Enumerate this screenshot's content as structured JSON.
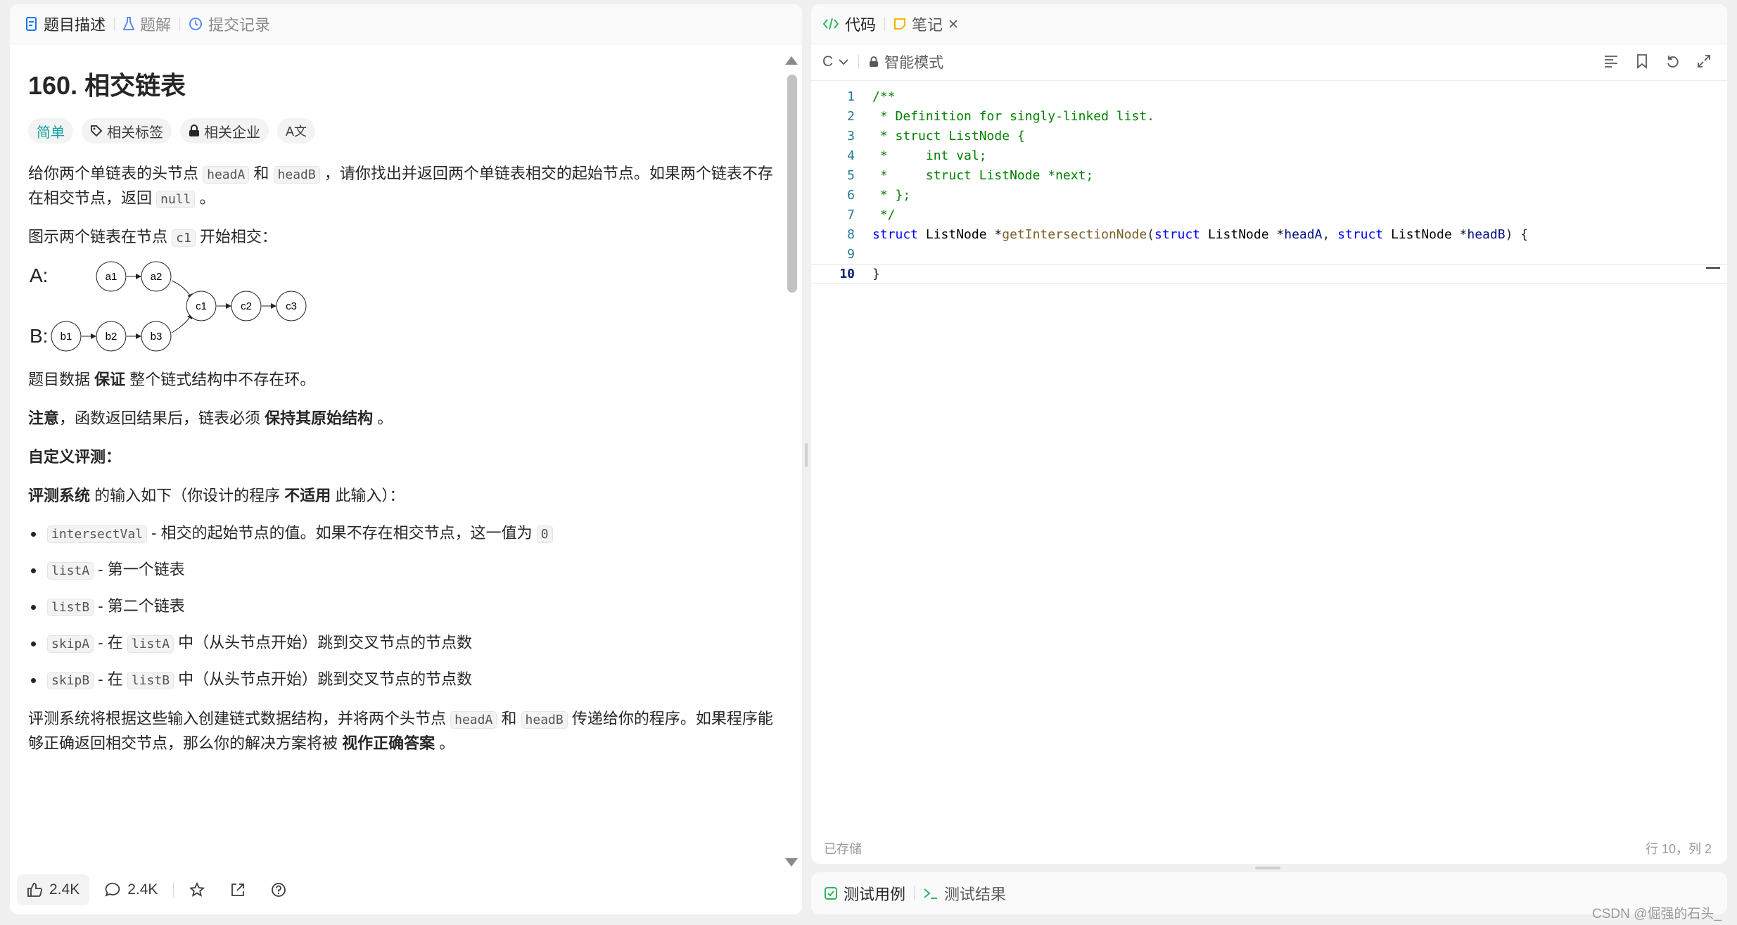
{
  "left_tabs": [
    {
      "label": "题目描述",
      "icon": "document-icon"
    },
    {
      "label": "题解",
      "icon": "flask-icon"
    },
    {
      "label": "提交记录",
      "icon": "history-icon"
    }
  ],
  "problem": {
    "title": "160. 相交链表",
    "tags": {
      "difficulty": "简单",
      "related_tags": "相关标签",
      "related_companies": "相关企业",
      "translate": "A文"
    },
    "intro": {
      "t1": "给你两个单链表的头节点 ",
      "c1": "headA",
      "t2": " 和 ",
      "c2": "headB",
      "t3": " ，请你找出并返回两个单链表相交的起始节点。如果两个链表不存在相交节点，返回 ",
      "c3": "null",
      "t4": " 。"
    },
    "diagram_intro": {
      "t1": "图示两个链表在节点 ",
      "c1": "c1",
      "t2": " 开始相交："
    },
    "diagram": {
      "label_a": "A:",
      "label_b": "B:",
      "nodes": {
        "a1": "a1",
        "a2": "a2",
        "c1": "c1",
        "c2": "c2",
        "c3": "c3",
        "b1": "b1",
        "b2": "b2",
        "b3": "b3"
      }
    },
    "guarantee": {
      "t1": "题目数据 ",
      "b1": "保证",
      "t2": " 整个链式结构中不存在环。"
    },
    "note": {
      "b1": "注意",
      "t1": "，函数返回结果后，链表必须 ",
      "b2": "保持其原始结构",
      "t2": " 。"
    },
    "custom_judge_heading": "自定义评测：",
    "judge_intro": {
      "b1": "评测系统",
      "t1": " 的输入如下（你设计的程序 ",
      "b2": "不适用",
      "t2": " 此输入）："
    },
    "bullets": [
      {
        "c1": "intersectVal",
        "t1": " - 相交的起始节点的值。如果不存在相交节点，这一值为 ",
        "c2": "0",
        "t2": ""
      },
      {
        "c1": "listA",
        "t1": " - 第一个链表",
        "c2": "",
        "t2": ""
      },
      {
        "c1": "listB",
        "t1": " - 第二个链表",
        "c2": "",
        "t2": ""
      },
      {
        "c1": "skipA",
        "t1": " - 在 ",
        "c2": "listA",
        "t2": " 中（从头节点开始）跳到交叉节点的节点数"
      },
      {
        "c1": "skipB",
        "t1": " - 在 ",
        "c2": "listB",
        "t2": " 中（从头节点开始）跳到交叉节点的节点数"
      }
    ],
    "closing": {
      "t1": "评测系统将根据这些输入创建链式数据结构，并将两个头节点 ",
      "c1": "headA",
      "t2": " 和 ",
      "c2": "headB",
      "t3": " 传递给你的程序。如果程序能够正确返回相交节点，那么你的解决方案将被 ",
      "b1": "视作正确答案",
      "t4": " 。"
    }
  },
  "footer": {
    "likes": "2.4K",
    "comments": "2.4K"
  },
  "right_tabs": [
    {
      "label": "代码",
      "icon": "code-icon"
    },
    {
      "label": "笔记",
      "icon": "note-icon"
    }
  ],
  "editor": {
    "language": "C",
    "mode": "智能模式",
    "status_left": "已存储",
    "status_right": "行 10，列 2",
    "line_numbers": [
      "1",
      "2",
      "3",
      "4",
      "5",
      "6",
      "7",
      "8",
      "9",
      "10"
    ],
    "lines": [
      "/**",
      " * Definition for singly-linked list.",
      " * struct ListNode {",
      " *     int val;",
      " *     struct ListNode *next;",
      " * };",
      " */",
      "",
      "",
      "}"
    ],
    "line8": {
      "kw1": "struct",
      "t1": " ListNode *",
      "fn": "getIntersectionNode",
      "t2": "(",
      "kw2": "struct",
      "t3": " ListNode *",
      "p1": "headA",
      "t4": ", ",
      "kw3": "struct",
      "t5": " ListNode *",
      "p2": "headB",
      "t6": ") {"
    }
  },
  "bottom_tabs": [
    {
      "label": "测试用例",
      "icon": "checkbox-icon"
    },
    {
      "label": "测试结果",
      "icon": "terminal-icon"
    }
  ],
  "watermark": "CSDN @倔强的石头_",
  "colors": {
    "accent_blue": "#1a73e8",
    "easy": "#16a2a2",
    "green": "#2db55d",
    "note_yellow": "#f5b800"
  }
}
